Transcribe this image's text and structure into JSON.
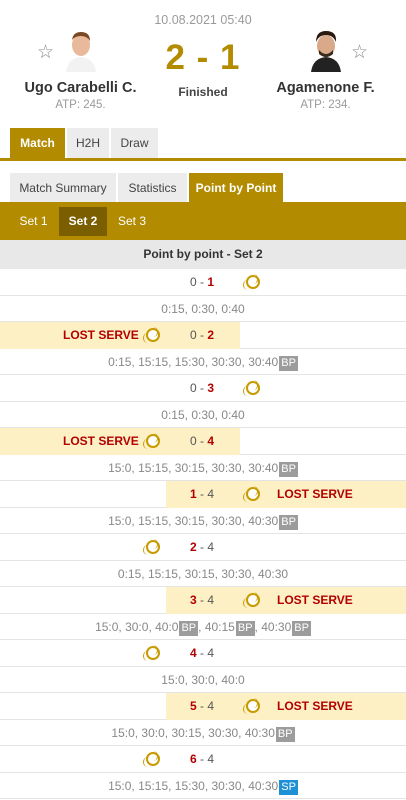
{
  "match": {
    "date": "10.08.2021 05:40",
    "score": "2 - 1",
    "status": "Finished",
    "home": {
      "name": "Ugo Carabelli C.",
      "atp": "ATP: 245."
    },
    "away": {
      "name": "Agamenone F.",
      "atp": "ATP: 234."
    }
  },
  "tabs_main": [
    "Match",
    "H2H",
    "Draw"
  ],
  "tabs_sub": [
    "Match Summary",
    "Statistics",
    "Point by Point"
  ],
  "sets": [
    "Set 1",
    "Set 2",
    "Set 3"
  ],
  "pbp_title": "Point by point - Set 2",
  "lost_serve_label": "LOST SERVE",
  "games": [
    {
      "home": "0",
      "away": "1",
      "server": "away",
      "winner": "away",
      "lost_serve": false,
      "points": "0:15, 0:30, 0:40",
      "badges": []
    },
    {
      "home": "0",
      "away": "2",
      "server": "home",
      "winner": "away",
      "lost_serve": true,
      "points": "0:15, 15:15, 15:30, 30:30, 30:40",
      "badges": [
        "BP"
      ]
    },
    {
      "home": "0",
      "away": "3",
      "server": "away",
      "winner": "away",
      "lost_serve": false,
      "points": "0:15, 0:30, 0:40",
      "badges": []
    },
    {
      "home": "0",
      "away": "4",
      "server": "home",
      "winner": "away",
      "lost_serve": true,
      "points": "15:0, 15:15, 30:15, 30:30, 30:40",
      "badges": [
        "BP"
      ]
    },
    {
      "home": "1",
      "away": "4",
      "server": "away",
      "winner": "home",
      "lost_serve": true,
      "points": "15:0, 15:15, 30:15, 30:30, 40:30",
      "badges": [
        "BP"
      ]
    },
    {
      "home": "2",
      "away": "4",
      "server": "home",
      "winner": "home",
      "lost_serve": false,
      "points": "0:15, 15:15, 30:15, 30:30, 40:30",
      "badges": []
    },
    {
      "home": "3",
      "away": "4",
      "server": "away",
      "winner": "home",
      "lost_serve": true,
      "points_parts": [
        "15:0, 30:0, 40:0",
        "BP",
        ", 40:15",
        "BP",
        ", 40:30",
        "BP"
      ]
    },
    {
      "home": "4",
      "away": "4",
      "server": "home",
      "winner": "home",
      "lost_serve": false,
      "points": "15:0, 30:0, 40:0",
      "badges": []
    },
    {
      "home": "5",
      "away": "4",
      "server": "away",
      "winner": "home",
      "lost_serve": true,
      "points": "15:0, 30:0, 30:15, 30:30, 40:30",
      "badges": [
        "BP"
      ]
    },
    {
      "home": "6",
      "away": "4",
      "server": "home",
      "winner": "home",
      "lost_serve": false,
      "points": "15:0, 15:15, 15:30, 30:30, 40:30",
      "badges": [
        "SP"
      ]
    }
  ],
  "colors": {
    "accent": "#b38b00",
    "lost": "#b30000",
    "highlight": "#fdf0c4",
    "bp": "#9c9c9c",
    "sp": "#1e90d6"
  }
}
